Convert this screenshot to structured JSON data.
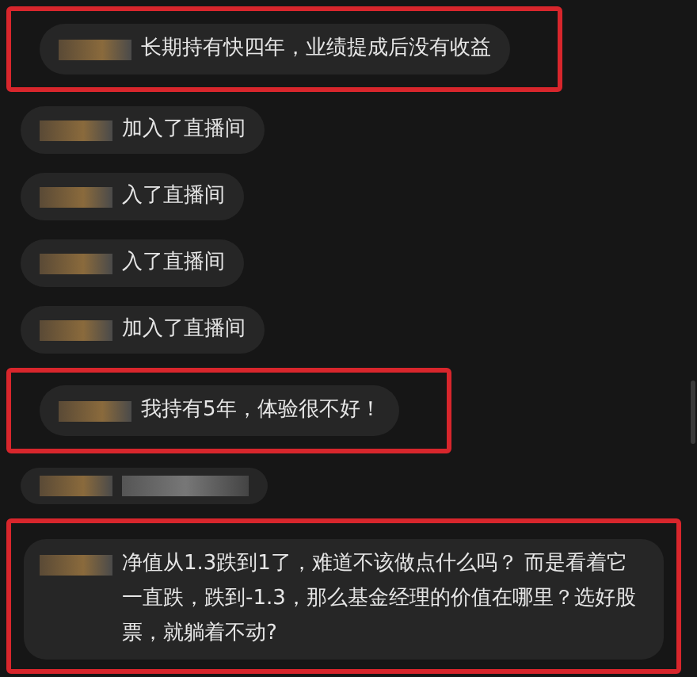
{
  "messages": [
    {
      "kind": "comment",
      "highlighted": true,
      "text": "长期持有快四年，业绩提成后没有收益"
    },
    {
      "kind": "join",
      "highlighted": false,
      "text": "加入了直播间"
    },
    {
      "kind": "join",
      "highlighted": false,
      "text": "入了直播间"
    },
    {
      "kind": "join",
      "highlighted": false,
      "text": "入了直播间"
    },
    {
      "kind": "join",
      "highlighted": false,
      "text": "加入了直播间"
    },
    {
      "kind": "comment",
      "highlighted": true,
      "text": "我持有5年，体验很不好！"
    },
    {
      "kind": "blank",
      "highlighted": false
    },
    {
      "kind": "comment",
      "highlighted": true,
      "text": "净值从1.3跌到1了，难道不该做点什么吗？ 而是看着它一直跌，跌到-1.3，那么基金经理的价值在哪里？选好股票，就躺着不动?"
    }
  ]
}
